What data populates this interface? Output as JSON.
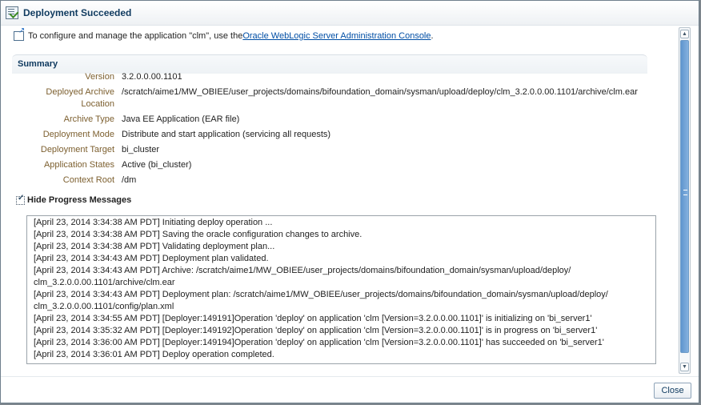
{
  "dialog": {
    "title": "Deployment Succeeded",
    "info": {
      "prefix": "To configure and manage the application \"clm\", use the ",
      "link": "Oracle WebLogic Server Administration Console",
      "suffix": "."
    },
    "summary": {
      "title": "Summary",
      "fields": [
        {
          "label": "Version",
          "value": "3.2.0.0.00.1101"
        },
        {
          "label": "Deployed Archive",
          "value": "/scratch/aime1/MW_OBIEE/user_projects/domains/bifoundation_domain/sysman/upload/deploy/clm_3.2.0.0.00.1101/archive/clm.ear"
        },
        {
          "label": "Location",
          "value": ""
        },
        {
          "label": "Archive Type",
          "value": "Java EE Application (EAR file)"
        },
        {
          "label": "Deployment Mode",
          "value": "Distribute and start application (servicing all requests)"
        },
        {
          "label": "Deployment Target",
          "value": "bi_cluster"
        },
        {
          "label": "Application States",
          "value": "Active (bi_cluster)"
        },
        {
          "label": "Context Root",
          "value": "/dm"
        }
      ]
    },
    "progress": {
      "hide_label": "Hide Progress Messages",
      "lines": [
        "[April 23, 2014 3:34:38 AM PDT] Initiating deploy operation ...",
        "[April 23, 2014 3:34:38 AM PDT] Saving the oracle configuration changes to archive.",
        "[April 23, 2014 3:34:38 AM PDT] Validating deployment plan...",
        "[April 23, 2014 3:34:43 AM PDT] Deployment plan validated.",
        "[April 23, 2014 3:34:43 AM PDT] Archive: /scratch/aime1/MW_OBIEE/user_projects/domains/bifoundation_domain/sysman/upload/deploy/",
        "clm_3.2.0.0.00.1101/archive/clm.ear",
        "[April 23, 2014 3:34:43 AM PDT] Deployment plan: /scratch/aime1/MW_OBIEE/user_projects/domains/bifoundation_domain/sysman/upload/deploy/",
        "clm_3.2.0.0.00.1101/config/plan.xml",
        "[April 23, 2014 3:34:55 AM PDT] [Deployer:149191]Operation 'deploy' on application 'clm [Version=3.2.0.0.00.1101]' is initializing on 'bi_server1'",
        "[April 23, 2014 3:35:32 AM PDT] [Deployer:149192]Operation 'deploy' on application 'clm [Version=3.2.0.0.00.1101]' is in progress on 'bi_server1'",
        "[April 23, 2014 3:36:00 AM PDT] [Deployer:149194]Operation 'deploy' on application 'clm [Version=3.2.0.0.00.1101]' has succeeded on 'bi_server1'",
        "[April 23, 2014 3:36:01 AM PDT] Deploy operation completed."
      ]
    },
    "close_label": "Close"
  }
}
